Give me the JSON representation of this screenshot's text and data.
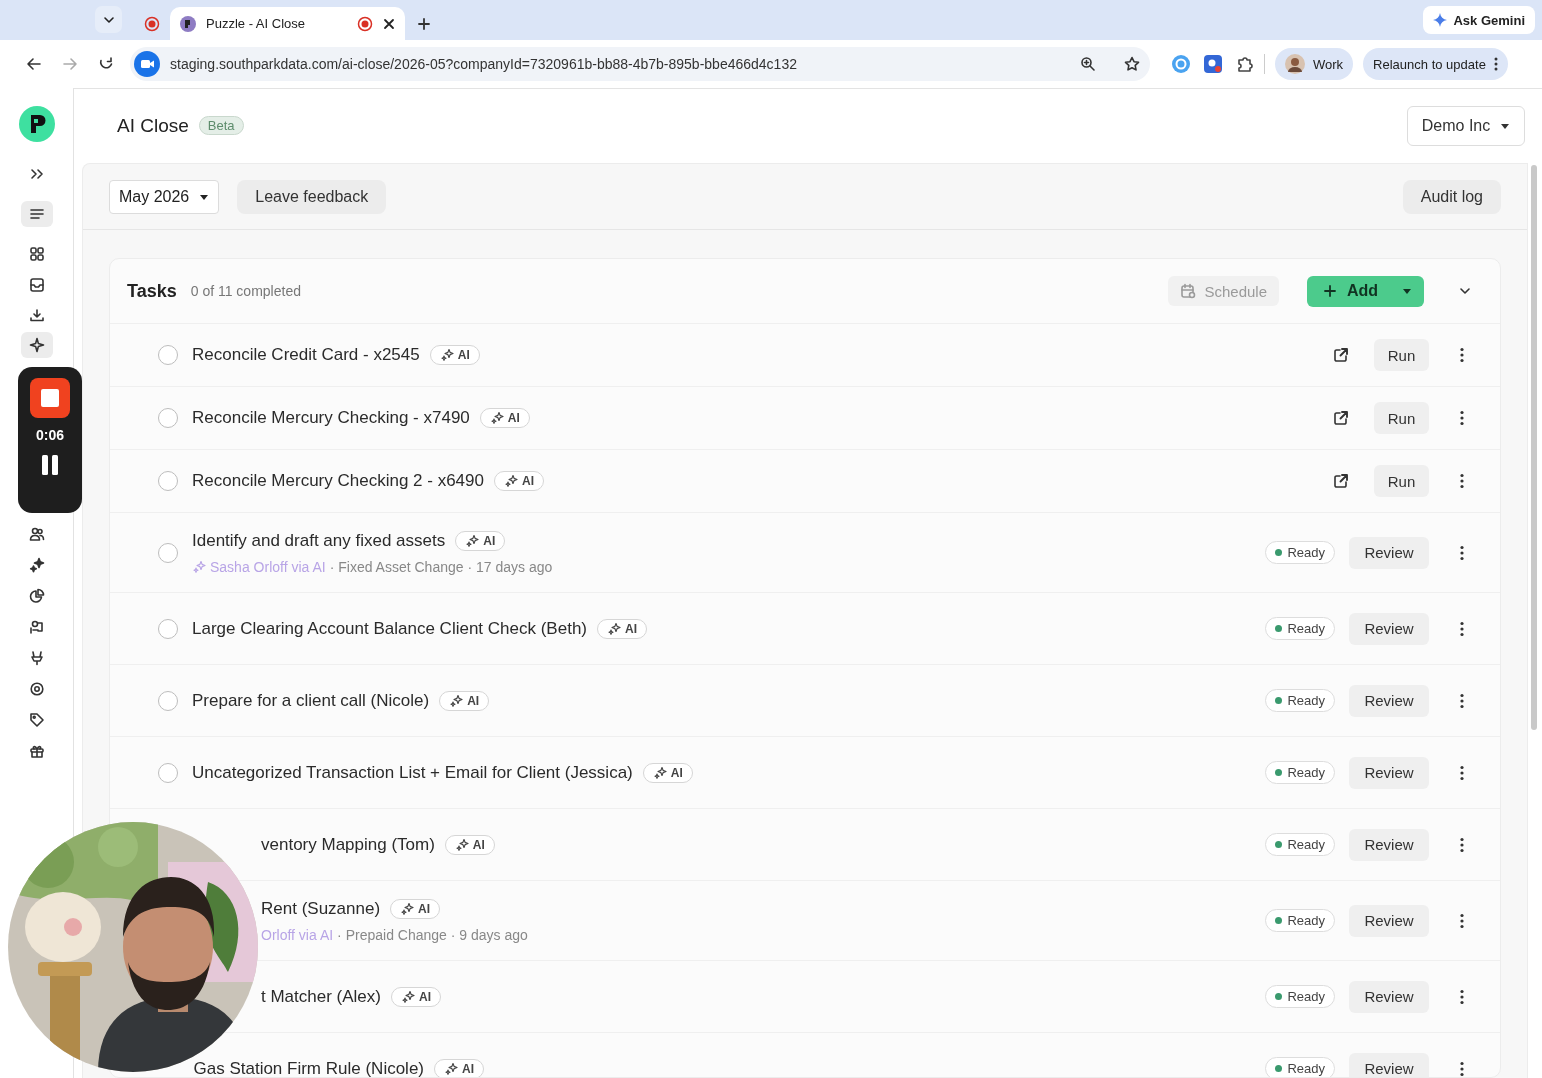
{
  "browser": {
    "tabs": [
      {
        "selected": false
      },
      {
        "title": "Puzzle - AI Close",
        "selected": true
      }
    ],
    "ask_gemini": "Ask Gemini",
    "url": "staging.southparkdata.com/ai-close/2026-05?companyId=7320961b-bb88-4b7b-895b-bbe466d4c132",
    "profile": "Work",
    "relaunch": "Relaunch to update"
  },
  "sidebar": {
    "items": [
      {
        "selected": false
      },
      {
        "selected": true
      },
      {
        "selected": false
      },
      {
        "selected": false
      },
      {
        "selected": false
      },
      {
        "selected": true
      },
      {
        "selected": false
      },
      {
        "selected": false
      },
      {
        "selected": false
      },
      {
        "selected": false
      },
      {
        "selected": false
      },
      {
        "selected": false
      },
      {
        "selected": false
      },
      {
        "selected": false
      }
    ]
  },
  "recorder": {
    "time": "0:06"
  },
  "header": {
    "title": "AI Close",
    "badge": "Beta",
    "company": "Demo Inc"
  },
  "toolbar": {
    "period": "May 2026",
    "feedback": "Leave feedback",
    "audit": "Audit log"
  },
  "tasks": {
    "title": "Tasks",
    "progress": "0 of 11 completed",
    "schedule": "Schedule",
    "add": "Add",
    "items": [
      {
        "kind": "run",
        "checked": false,
        "title": "Reconcile Credit Card - x2545",
        "badge": "AI",
        "action": "Run"
      },
      {
        "kind": "run",
        "checked": false,
        "title": "Reconcile Mercury Checking - x7490",
        "badge": "AI",
        "action": "Run"
      },
      {
        "kind": "run",
        "checked": false,
        "title": "Reconcile Mercury Checking 2 - x6490",
        "badge": "AI",
        "action": "Run"
      },
      {
        "kind": "review",
        "checked": false,
        "title": "Identify and draft any fixed assets",
        "badge": "AI",
        "author": "Sasha Orloff via AI",
        "detail": "· Fixed Asset Change · 17 days ago",
        "status": "Ready",
        "action": "Review"
      },
      {
        "kind": "review",
        "checked": false,
        "title": "Large Clearing Account Balance Client Check (Beth)",
        "badge": "AI",
        "status": "Ready",
        "action": "Review"
      },
      {
        "kind": "review",
        "checked": false,
        "title": "Prepare for a client call (Nicole)",
        "badge": "AI",
        "status": "Ready",
        "action": "Review"
      },
      {
        "kind": "review",
        "checked": false,
        "title": "Uncategorized Transaction List + Email for Client (Jessica)",
        "badge": "AI",
        "status": "Ready",
        "action": "Review"
      },
      {
        "kind": "review_covered",
        "title": "ventory Mapping (Tom)",
        "badge": "AI",
        "status": "Ready",
        "action": "Review"
      },
      {
        "kind": "review_covered",
        "title": "Rent (Suzanne)",
        "badge": "AI",
        "author": "Orloff via AI",
        "detail": "· Prepaid Change · 9 days ago",
        "status": "Ready",
        "action": "Review"
      },
      {
        "kind": "review_covered",
        "title": "t Matcher (Alex)",
        "badge": "AI",
        "status": "Ready",
        "action": "Review"
      },
      {
        "kind": "review",
        "title": "Gas Station Firm Rule (Nicole)",
        "badge": "AI",
        "status": "Ready",
        "action": "Review"
      }
    ]
  }
}
